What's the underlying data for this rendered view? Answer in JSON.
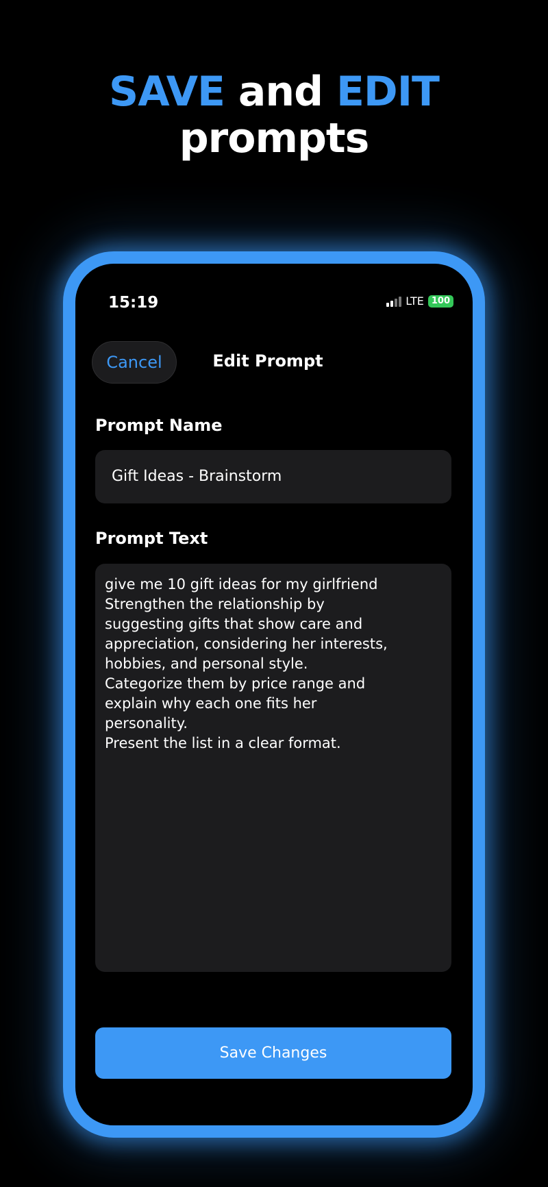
{
  "headline": {
    "word1": "SAVE",
    "word2": " and ",
    "word3": "EDIT",
    "line2": "prompts"
  },
  "status_bar": {
    "time": "15:19",
    "network": "LTE",
    "battery": "100"
  },
  "nav": {
    "cancel_label": "Cancel",
    "title": "Edit Prompt"
  },
  "form": {
    "name_label": "Prompt Name",
    "name_value": "Gift Ideas - Brainstorm",
    "text_label": "Prompt Text",
    "text_value": "give me 10 gift ideas for my girlfriend\nStrengthen the relationship by\nsuggesting gifts that show care and\nappreciation, considering her interests,\nhobbies, and personal style.\nCategorize them by price range and\nexplain why each one fits her\npersonality.\nPresent the list in a clear format."
  },
  "actions": {
    "save_label": "Save Changes"
  },
  "colors": {
    "accent": "#3d98f5",
    "background": "#000000",
    "field_bg": "#1c1c1e",
    "battery": "#34c759"
  }
}
